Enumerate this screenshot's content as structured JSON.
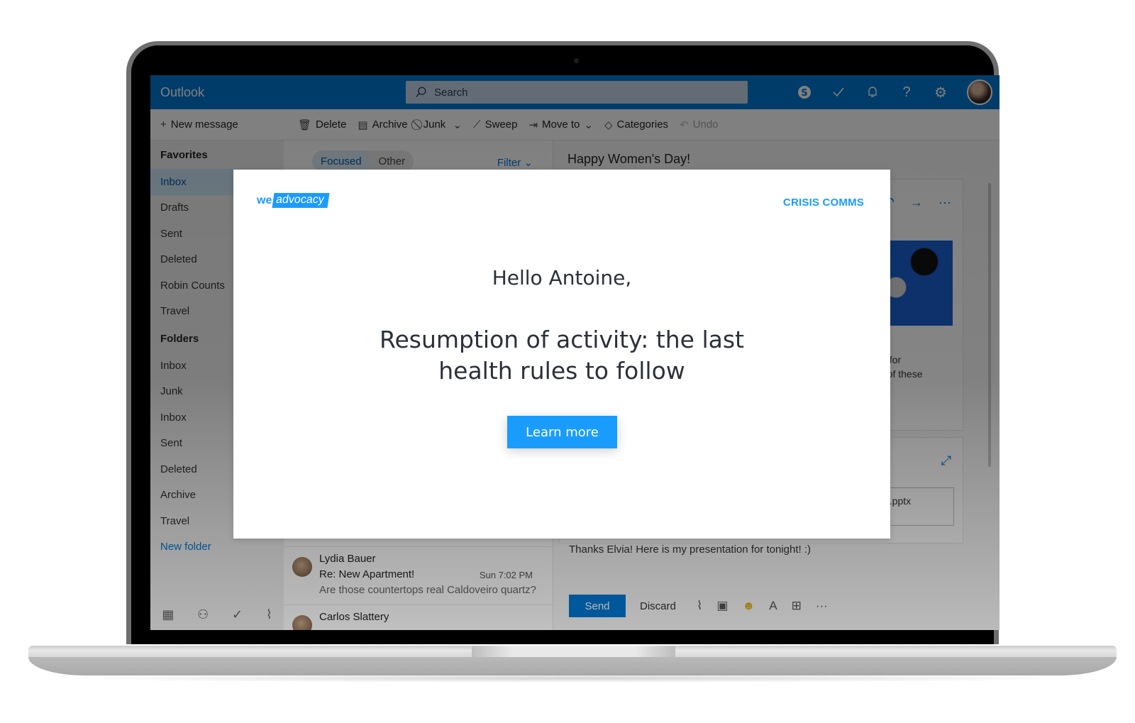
{
  "outlook": {
    "app_name": "Outlook",
    "search": {
      "placeholder": "Search",
      "icon": "search-icon"
    },
    "top_icons": [
      "skype-icon",
      "todo-check-icon",
      "bell-icon",
      "help-icon",
      "gear-icon",
      "avatar"
    ],
    "commands": {
      "new_message": "New message",
      "delete": "Delete",
      "archive": "Archive",
      "junk": "Junk",
      "sweep": "Sweep",
      "move_to": "Move to",
      "categories": "Categories",
      "undo": "Undo"
    },
    "sidebar": {
      "favorites_label": "Favorites",
      "favorites": [
        "Inbox",
        "Drafts",
        "Sent",
        "Deleted",
        "Robin Counts",
        "Travel"
      ],
      "folders_label": "Folders",
      "folders": [
        "Inbox",
        "Junk",
        "Inbox",
        "Sent",
        "Deleted",
        "Archive",
        "Travel"
      ],
      "new_folder": "New folder",
      "footer_icons": [
        "calendar-icon",
        "people-icon",
        "tasks-icon",
        "attachment-icon"
      ]
    },
    "message_list": {
      "tabs": [
        "Focused",
        "Other"
      ],
      "active_tab": "Focused",
      "filter": "Filter",
      "messages": [
        {
          "from": "Lydia Bauer",
          "subject": "Re: New Apartment!",
          "time": "Sun 7:02 PM",
          "preview": "Are those countertops real Caldoveiro quartz?"
        },
        {
          "from": "Carlos Slattery",
          "subject": "",
          "time": "",
          "preview": ""
        }
      ]
    },
    "reading_pane": {
      "subject": "Happy Women's Day!",
      "body_fragment": "in for\ne of these",
      "attachment_fragment": "n.pptx",
      "reply_text": "Thanks Elvia! Here is my presentation for tonight! :)",
      "send": "Send",
      "discard": "Discard"
    }
  },
  "modal": {
    "logo_we": "we",
    "logo_advocacy": "advocacy",
    "category": "CRISIS COMMS",
    "greeting": "Hello Antoine,",
    "headline": "Resumption of activity: the last health rules to follow",
    "cta": "Learn more",
    "accent_color": "#1a9cff"
  }
}
